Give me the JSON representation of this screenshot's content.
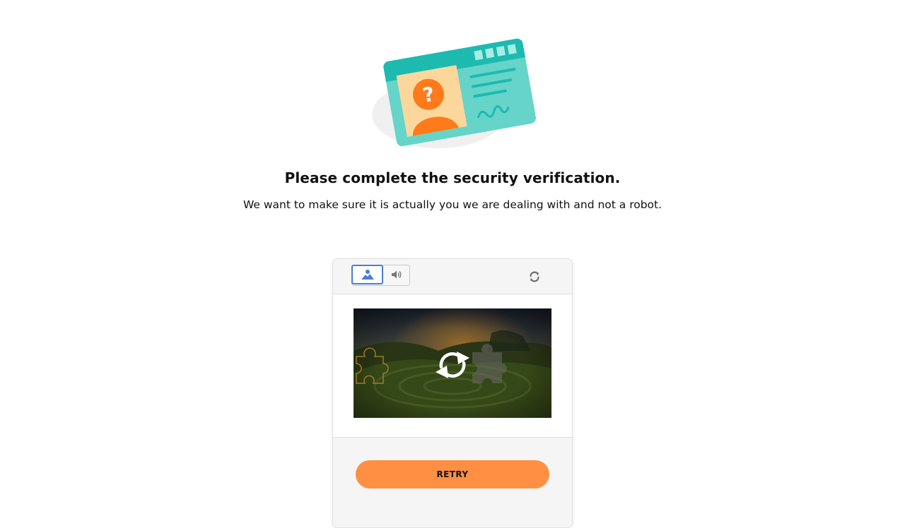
{
  "heading": {
    "title": "Please complete the security verification.",
    "subtitle": "We want to make sure it is actually you we are dealing with and not a robot."
  },
  "captcha": {
    "modes": [
      {
        "name": "image",
        "icon": "image-icon",
        "selected": true
      },
      {
        "name": "audio",
        "icon": "speaker-icon",
        "selected": false
      }
    ],
    "refresh_icon": "refresh-icon",
    "challenge_icon": "reload-arrows-icon",
    "retry_label": "RETRY"
  },
  "colors": {
    "accent": "#ff8f42",
    "selected_border": "#4a7dd4",
    "card_teal": "#5ccfc4",
    "card_header": "#1dbab0",
    "avatar_orange": "#ff7a1a"
  }
}
